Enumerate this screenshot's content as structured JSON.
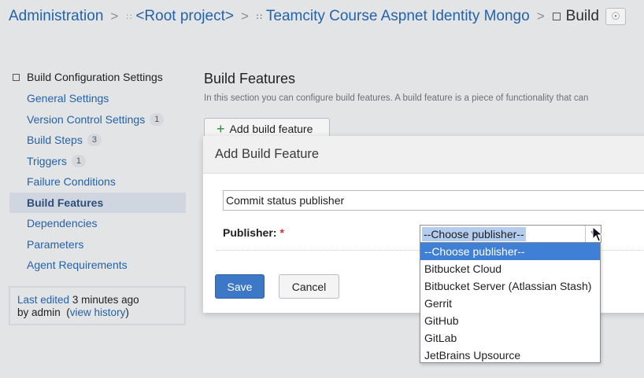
{
  "breadcrumb": {
    "items": [
      "Administration",
      "<Root project>",
      "Teamcity Course Aspnet Identity Mongo",
      "Build"
    ],
    "separator": ">"
  },
  "sidebar": {
    "heading": "Build Configuration Settings",
    "items": [
      {
        "label": "General Settings",
        "badge": ""
      },
      {
        "label": "Version Control Settings",
        "badge": "1"
      },
      {
        "label": "Build Steps",
        "badge": "3"
      },
      {
        "label": "Triggers",
        "badge": "1"
      },
      {
        "label": "Failure Conditions",
        "badge": ""
      },
      {
        "label": "Build Features",
        "badge": "",
        "active": true
      },
      {
        "label": "Dependencies",
        "badge": ""
      },
      {
        "label": "Parameters",
        "badge": ""
      },
      {
        "label": "Agent Requirements",
        "badge": ""
      }
    ],
    "last_edited": {
      "prefix": "Last edited",
      "time": "3 minutes ago",
      "by": "by admin",
      "open_paren": "(",
      "history_link": "view history",
      "close_paren": ")"
    }
  },
  "main": {
    "title": "Build Features",
    "description": "In this section you can configure build features. A build feature is a piece of functionality that can",
    "add_button": "Add build feature"
  },
  "dialog": {
    "title": "Add Build Feature",
    "feature_value": "Commit status publisher",
    "publisher_label": "Publisher:",
    "required_mark": "*",
    "select_value": "--Choose publisher--",
    "options": [
      "--Choose publisher--",
      "Bitbucket Cloud",
      "Bitbucket Server (Atlassian Stash)",
      "Gerrit",
      "GitHub",
      "GitLab",
      "JetBrains Upsource"
    ],
    "save": "Save",
    "cancel": "Cancel"
  },
  "colors": {
    "link": "#2463a8",
    "primary_button": "#3c78c5",
    "selected_option": "#3f7fd6",
    "required": "#d32f2f"
  }
}
